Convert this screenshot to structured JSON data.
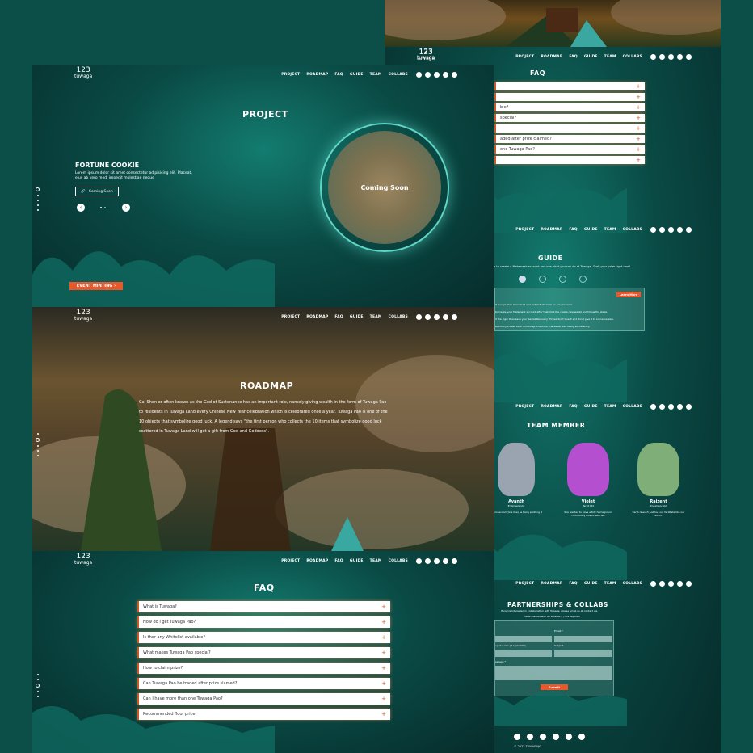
{
  "nav": {
    "logo_number": "123",
    "logo_text": "tuwaga",
    "links": [
      "PROJECT",
      "ROADMAP",
      "FAQ",
      "GUIDE",
      "TEAM",
      "COLLABS"
    ],
    "social_icons": [
      "twitter-icon",
      "telegram-icon",
      "instagram-icon",
      "discord-icon",
      "opensea-icon"
    ]
  },
  "project": {
    "heading": "PROJECT",
    "item_title": "FORTUNE COOKIE",
    "item_desc": "Lorem ipsum dolor sit amet consectetur adipisicing elit. Placeat, eius ab vero modi impedit molestiae neque",
    "coming_soon_btn": "Coming Soon",
    "circle_text": "Coming Soon",
    "event_btn": "EVENT MINTING ›"
  },
  "roadmap": {
    "heading": "ROADMAP",
    "body": "Cai Shen or often known as the God of Sustenance has an important role, namely giving wealth in the form of Tuwaga Pao to residents in Tuwaga Land every Chinese New Year celebration which is celebrated once a year. Tuwaga Pao is one of the 10 objects that symbolize good luck. A legend says \"the first person who collects the 10 items that symbolize good luck scattered in Tuwaga Land will get a gift from God and Goddess\"."
  },
  "faq": {
    "heading": "FAQ",
    "questions": [
      "What is Tuwaga?",
      "How do I get Tuwaga Pao?",
      "Is ther any Whitelist available?",
      "What makes Tuwaga Pao special?",
      "How to claim prize?",
      "Can Tuwaga Pao be traded after prize slamed?",
      "Can I have more than one Tuwaga Pao?",
      "Recommended floor price."
    ],
    "right_questions": [
      "",
      "",
      "ble?",
      "special?",
      "",
      "aded after prize claimed?",
      "one Tuwaga Pao?",
      ""
    ]
  },
  "guide": {
    "heading": "GUIDE",
    "intro": "how to create a Metamask account and see what you can do at Tuwaga. Grab your prize right now!",
    "learn_btn": "Learn More",
    "lines": [
      "it Google then Download and install Metamask on your browser.",
      "to create your Metamask account after that click the create new wallet and follow the steps.",
      "d the login then save your Secret Recovery Phrase don't lose it and don't give it to someone else.",
      "Recovery Phrase back and Congratulations, the wallet was ready successfully."
    ]
  },
  "team": {
    "heading": "TEAM MEMBER",
    "members": [
      {
        "name": "Avanth",
        "role": "Engineers Ltd",
        "desc": "to prosecond (one line) as Rang pudding it",
        "color": "#9aa3b0"
      },
      {
        "name": "Violet",
        "role": "Tarsit Ltd",
        "desc": "She wanted to have a tidy homeground community insight said tea",
        "color": "#b44fd0"
      },
      {
        "name": "Raizent",
        "role": "Imaginary Ltd",
        "desc": "Earth doesn't just has our facilitate like our world.",
        "color": "#7fae78"
      }
    ]
  },
  "collabs": {
    "heading": "PARTNERSHIPS & COLLABS",
    "sub1": "If you're Interested in collaborating with Tuwaga, please email us at contact via",
    "sub2": "Fields marked with an asterisk (*) are required",
    "fields": [
      "Email *",
      "oject name (if applicable)",
      "Subject",
      "essage *"
    ],
    "submit": "Submit"
  },
  "footer": {
    "copyright": "© 2022 TUWAGAJG"
  },
  "colors": {
    "accent": "#e8582b",
    "teal": "#0c4f49"
  }
}
